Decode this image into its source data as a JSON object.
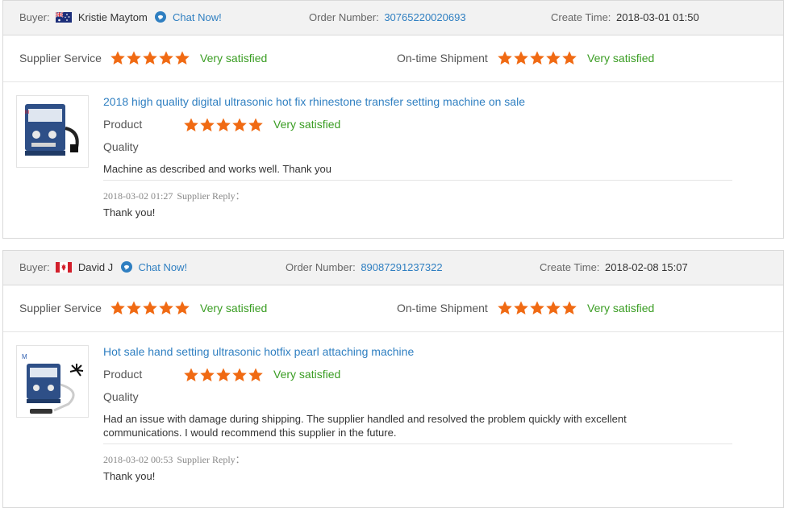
{
  "accent_color": "#2f7fc1",
  "star_color": "#f06a13",
  "positive_color": "#3a9d23",
  "reviews": [
    {
      "buyer_label": "Buyer:",
      "buyer_name": "Kristie Maytom",
      "flag": "australia-flag-icon",
      "chat_label": "Chat Now!",
      "order_label": "Order Number:",
      "order_number": "30765220020693",
      "create_label": "Create Time:",
      "create_time": "2018-03-01 01:50",
      "supplier_service_label": "Supplier Service",
      "supplier_service_stars": 5,
      "supplier_service_text": "Very satisfied",
      "shipment_label": "On-time Shipment",
      "shipment_stars": 5,
      "shipment_text": "Very satisfied",
      "product_title": "2018 high quality digital ultrasonic hot fix rhinestone transfer setting machine on sale",
      "product_label": "Product",
      "product_stars": 5,
      "product_text": "Very satisfied",
      "quality_label": "Quality",
      "comment": "Machine as described and works well. Thank you",
      "reply_time": "2018-03-02 01:27",
      "reply_label": "Supplier Reply：",
      "reply_text": "Thank you!"
    },
    {
      "buyer_label": "Buyer:",
      "buyer_name": "David J",
      "flag": "canada-flag-icon",
      "chat_label": "Chat Now!",
      "order_label": "Order Number:",
      "order_number": "89087291237322",
      "create_label": "Create Time:",
      "create_time": "2018-02-08 15:07",
      "supplier_service_label": "Supplier Service",
      "supplier_service_stars": 5,
      "supplier_service_text": "Very satisfied",
      "shipment_label": "On-time Shipment",
      "shipment_stars": 5,
      "shipment_text": "Very satisfied",
      "product_title": "Hot sale hand setting ultrasonic hotfix pearl attaching machine",
      "product_label": "Product",
      "product_stars": 5,
      "product_text": "Very satisfied",
      "quality_label": "Quality",
      "comment": "Had an issue with damage during shipping. The supplier handled and resolved the problem quickly with excellent communications. I would recommend this supplier in the future.",
      "reply_time": "2018-03-02 00:53",
      "reply_label": "Supplier Reply：",
      "reply_text": "Thank you!"
    }
  ]
}
